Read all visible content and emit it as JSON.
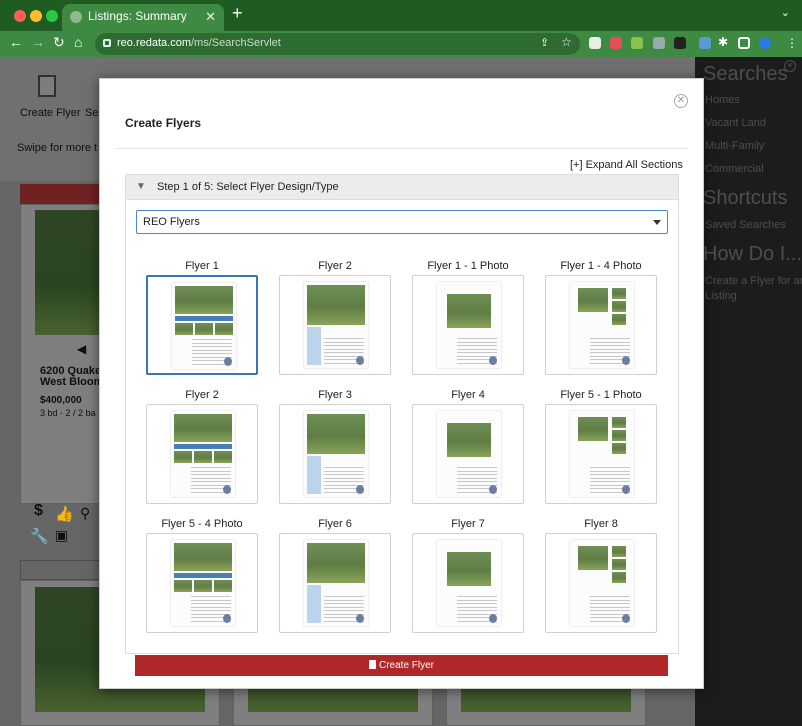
{
  "browser": {
    "tab_title": "Listings: Summary",
    "url_host": "reo.redata.com",
    "url_path": "/ms/SearchServlet"
  },
  "background": {
    "create_flyer_label": "Create Flyer",
    "se_label": "Se",
    "swipe_text": "Swipe for more t",
    "listing_address": "6200 Quake",
    "listing_city": "West Bloom",
    "listing_price": "$400,000",
    "listing_beds": "3 bd - 2 / 2 ba"
  },
  "sidebar": {
    "searches_title": "Searches",
    "items": [
      "Homes",
      "Vacant Land",
      "Multi-Family",
      "Commercial"
    ],
    "shortcuts_title": "Shortcuts",
    "shortcut_items": [
      "Saved Searches"
    ],
    "howdo_title": "How Do I...",
    "howdo_items": [
      "Create a Flyer for an",
      "Listing"
    ]
  },
  "modal": {
    "title": "Create Flyers",
    "expand_all": "[+] Expand All Sections",
    "step_title": "Step 1 of 5: Select Flyer Design/Type",
    "select_value": "REO Flyers",
    "button_label": "Create Flyer",
    "flyers": [
      "Flyer 1",
      "Flyer 2",
      "Flyer 1 - 1 Photo",
      "Flyer 1 - 4 Photo",
      "Flyer 2",
      "Flyer 3",
      "Flyer 4",
      "Flyer 5 - 1 Photo",
      "Flyer 5 - 4 Photo",
      "Flyer 6",
      "Flyer 7",
      "Flyer 8"
    ]
  },
  "colors": {
    "browser_green": "#3f8a42",
    "button_red": "#b0272a",
    "selected_border": "#3c75b3"
  }
}
